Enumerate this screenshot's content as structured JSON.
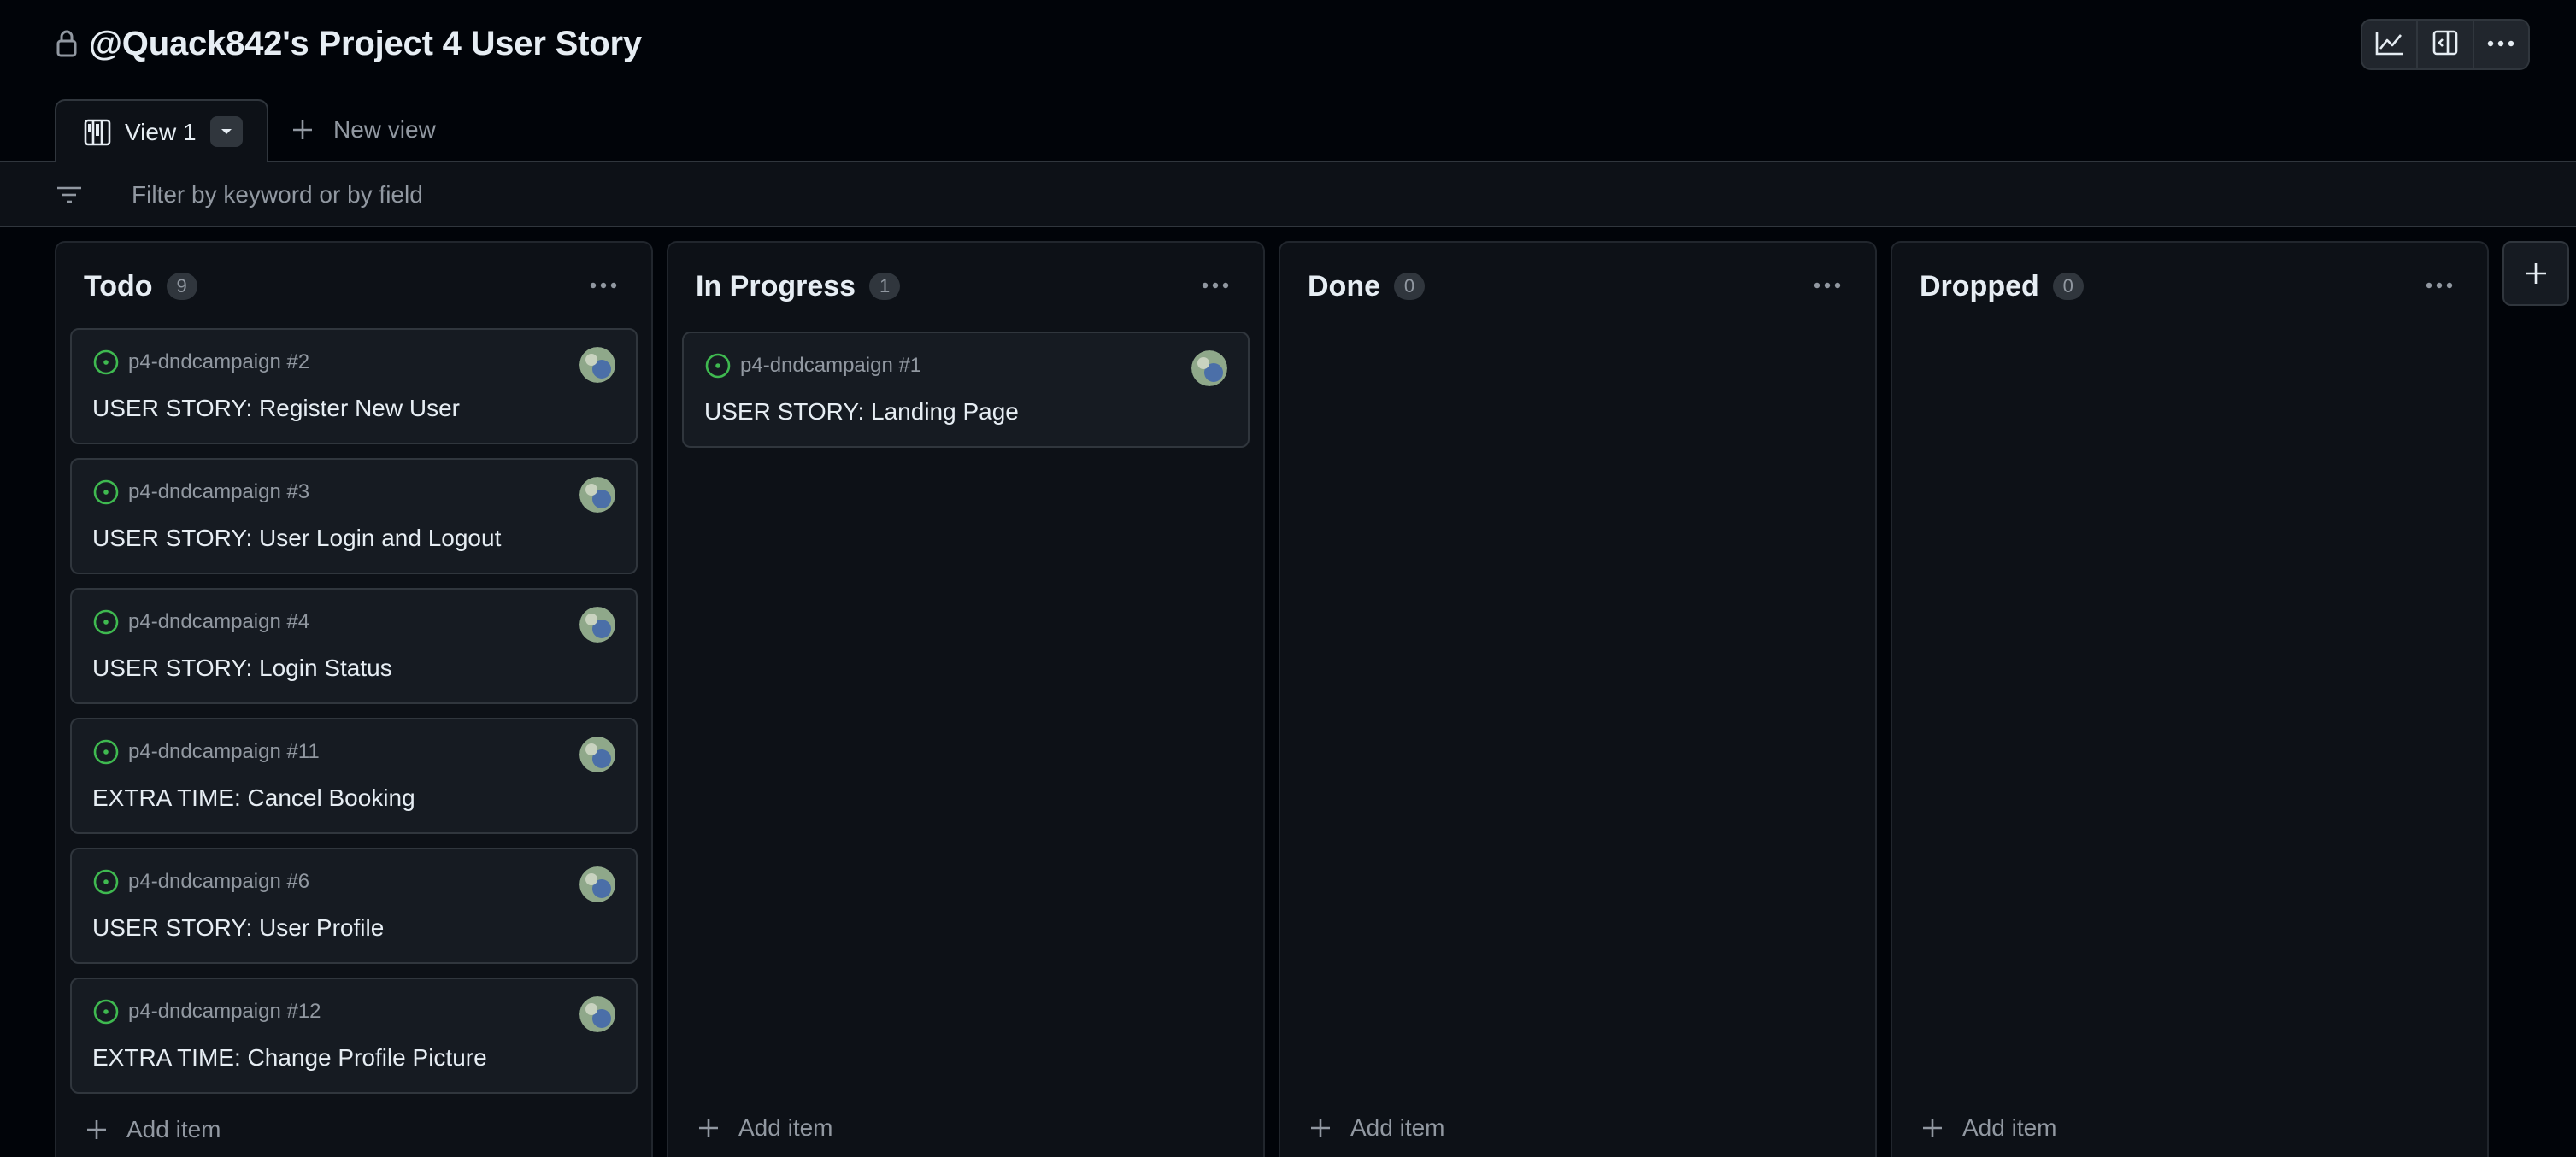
{
  "header": {
    "title": "@Quack842's Project 4 User Story"
  },
  "tabs": {
    "active": "View 1",
    "new_view": "New view"
  },
  "filter": {
    "placeholder": "Filter by keyword or by field"
  },
  "colors": {
    "background": "#010409",
    "surface": "#0d1117",
    "card": "#161b22",
    "border": "#30363d",
    "text": "#e6edf3",
    "muted": "#9198a1",
    "open_issue": "#3fb950"
  },
  "columns": [
    {
      "title": "Todo",
      "count": "9",
      "add_label": "Add item",
      "cards": [
        {
          "repo": "p4-dndcampaign #2",
          "title": "USER STORY: Register New User"
        },
        {
          "repo": "p4-dndcampaign #3",
          "title": "USER STORY: User Login and Logout"
        },
        {
          "repo": "p4-dndcampaign #4",
          "title": "USER STORY: Login Status"
        },
        {
          "repo": "p4-dndcampaign #11",
          "title": "EXTRA TIME: Cancel Booking"
        },
        {
          "repo": "p4-dndcampaign #6",
          "title": "USER STORY: User Profile"
        },
        {
          "repo": "p4-dndcampaign #12",
          "title": "EXTRA TIME: Change Profile Picture"
        }
      ]
    },
    {
      "title": "In Progress",
      "count": "1",
      "add_label": "Add item",
      "cards": [
        {
          "repo": "p4-dndcampaign #1",
          "title": "USER STORY: Landing Page"
        }
      ]
    },
    {
      "title": "Done",
      "count": "0",
      "add_label": "Add item",
      "cards": []
    },
    {
      "title": "Dropped",
      "count": "0",
      "add_label": "Add item",
      "cards": []
    }
  ],
  "icons": {
    "lock": "lock-icon",
    "insights": "graph-icon",
    "side_panel": "sidebar-icon",
    "more": "kebab-horizontal-icon",
    "board": "board-layout-icon",
    "triangle_down": "triangle-down-icon",
    "plus": "plus-icon",
    "filter": "filter-icon",
    "issue_open": "issue-opened-icon",
    "avatar": "avatar"
  }
}
